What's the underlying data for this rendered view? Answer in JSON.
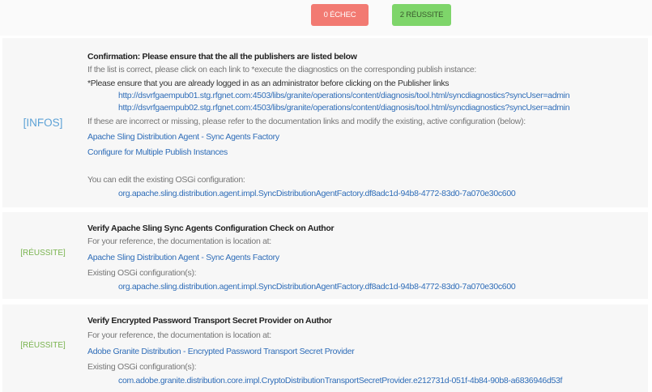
{
  "summary": {
    "fail_label": "0 ÉCHEC",
    "success_label": "2 RÉUSSITE"
  },
  "colors": {
    "fail": "#f27a72",
    "success": "#7ed56a",
    "link": "#2f6db8",
    "info": "#5da2d6"
  },
  "checks": [
    {
      "status": "[INFOS]",
      "title": "Confirmation: Please ensure that the all the publishers are listed below",
      "line1": "If the list is correct, please click on each link to *execute the diagnostics on the corresponding publish instance:",
      "line2": "*Please ensure that you are already logged in as an administrator before clicking on the Publisher links",
      "publisher_links": [
        "http://dsvrfgaempub01.stg.rfgnet.com:4503/libs/granite/operations/content/diagnosis/tool.html/syncdiagnostics?syncUser=admin",
        "http://dsvrfgaempub02.stg.rfgnet.com:4503/libs/granite/operations/content/diagnosis/tool.html/syncdiagnostics?syncUser=admin"
      ],
      "line3": "If these are incorrect or missing, please refer to the documentation links and modify the existing, active configuration (below):",
      "doc_links": [
        "Apache Sling Distribution Agent - Sync Agents Factory",
        "Configure for Multiple Publish Instances"
      ],
      "edit_text": "You can edit the existing OSGi configuration:",
      "config": "org.apache.sling.distribution.agent.impl.SyncDistributionAgentFactory.df8adc1d-94b8-4772-83d0-7a070e30c600"
    },
    {
      "status": "[RÉUSSITE]",
      "title": "Verify Apache Sling Sync Agents Configuration Check on Author",
      "ref_text": "For your reference, the documentation is location at:",
      "doc_link": "Apache Sling Distribution Agent - Sync Agents Factory",
      "existing_text": "Existing OSGi configuration(s):",
      "config": "org.apache.sling.distribution.agent.impl.SyncDistributionAgentFactory.df8adc1d-94b8-4772-83d0-7a070e30c600"
    },
    {
      "status": "[RÉUSSITE]",
      "title": "Verify Encrypted Password Transport Secret Provider on Author",
      "ref_text": "For your reference, the documentation is location at:",
      "doc_link": "Adobe Granite Distribution - Encrypted Password Transport Secret Provider",
      "existing_text": "Existing OSGi configuration(s):",
      "config": "com.adobe.granite.distribution.core.impl.CryptoDistributionTransportSecretProvider.e212731d-051f-4b84-90b8-a6836946d53f"
    }
  ]
}
